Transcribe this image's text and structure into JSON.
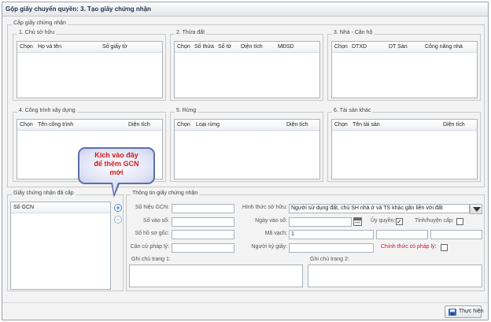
{
  "window": {
    "title": "Gộp giấy chuyển quyền: 3. Tạo giấy chứng nhận"
  },
  "cap_giay": {
    "legend": "Cấp giấy chứng nhận",
    "chu_so_huu": {
      "legend": "1. Chủ sở hữu",
      "columns": [
        "Chọn",
        "Họ và tên",
        "Số giấy tờ"
      ]
    },
    "thua_dat": {
      "legend": "2. Thửa đất",
      "columns": [
        "Chọn",
        "Số thửa",
        "Số tờ",
        "Diện tích",
        "MĐSD"
      ]
    },
    "nha_can_ho": {
      "legend": "3. Nhà - Căn hộ",
      "columns": [
        "Chọn",
        "DTXD",
        "DT Sàn",
        "Công năng nhà"
      ]
    },
    "cong_trinh": {
      "legend": "4. Công trình xây dựng",
      "columns": [
        "Chọn",
        "Tên công trình",
        "Diện tích"
      ]
    },
    "rung": {
      "legend": "5. Rừng",
      "columns": [
        "Chọn",
        "Loại rừng",
        "Diện tích"
      ]
    },
    "tai_san_khac": {
      "legend": "6. Tài sản khác",
      "columns": [
        "Chọn",
        "Tên tài sản",
        "Diện tích"
      ]
    }
  },
  "callout": {
    "line1": "Kích vào đây",
    "line2": "để thêm GCN",
    "line3": "mới"
  },
  "gcn_da_cap": {
    "legend": "Giấy chứng nhận đã cấp",
    "column": "Số GCN",
    "add_icon": "plus-circle-icon",
    "remove_icon": "minus-circle-icon"
  },
  "thong_tin": {
    "legend": "Thông tin giấy chứng nhận",
    "so_hieu_label": "Số hiệu GCN:",
    "so_hieu_value": "",
    "so_vao_so_label": "Số vào sổ:",
    "so_ho_so_goc_label": "Số hồ sơ gốc:",
    "can_cu_label": "Căn cứ pháp lý:",
    "hinh_thuc_label": "Hình thức sở hữu:",
    "hinh_thuc_value": "Người sử dụng đất, chủ SH nhà ở và TS khác gắn liền với đất",
    "ngay_vao_so_label": "Ngày vào sổ:",
    "uy_quyen_label": "Ủy quyền:",
    "uy_quyen_checked": "✓",
    "tinh_huyen_label": "Tỉnh/huyện cấp:",
    "ma_vach_label": "Mã vạch:",
    "ma_vach_value": "1",
    "nguoi_ky_label": "Người ký giấy:",
    "chinh_thuc_label": "Chính thức có pháp lý:",
    "ghi_chu_1_label": "Ghi chú trang 1:",
    "ghi_chu_2_label": "Ghi chú trang 2:"
  },
  "footer": {
    "save_label": "Thực hiện",
    "save_icon": "floppy-disk-icon"
  },
  "colors": {
    "callout_text": "#d31a1a",
    "callout_border": "#5f6fa8",
    "required_label": "#c8102e"
  }
}
